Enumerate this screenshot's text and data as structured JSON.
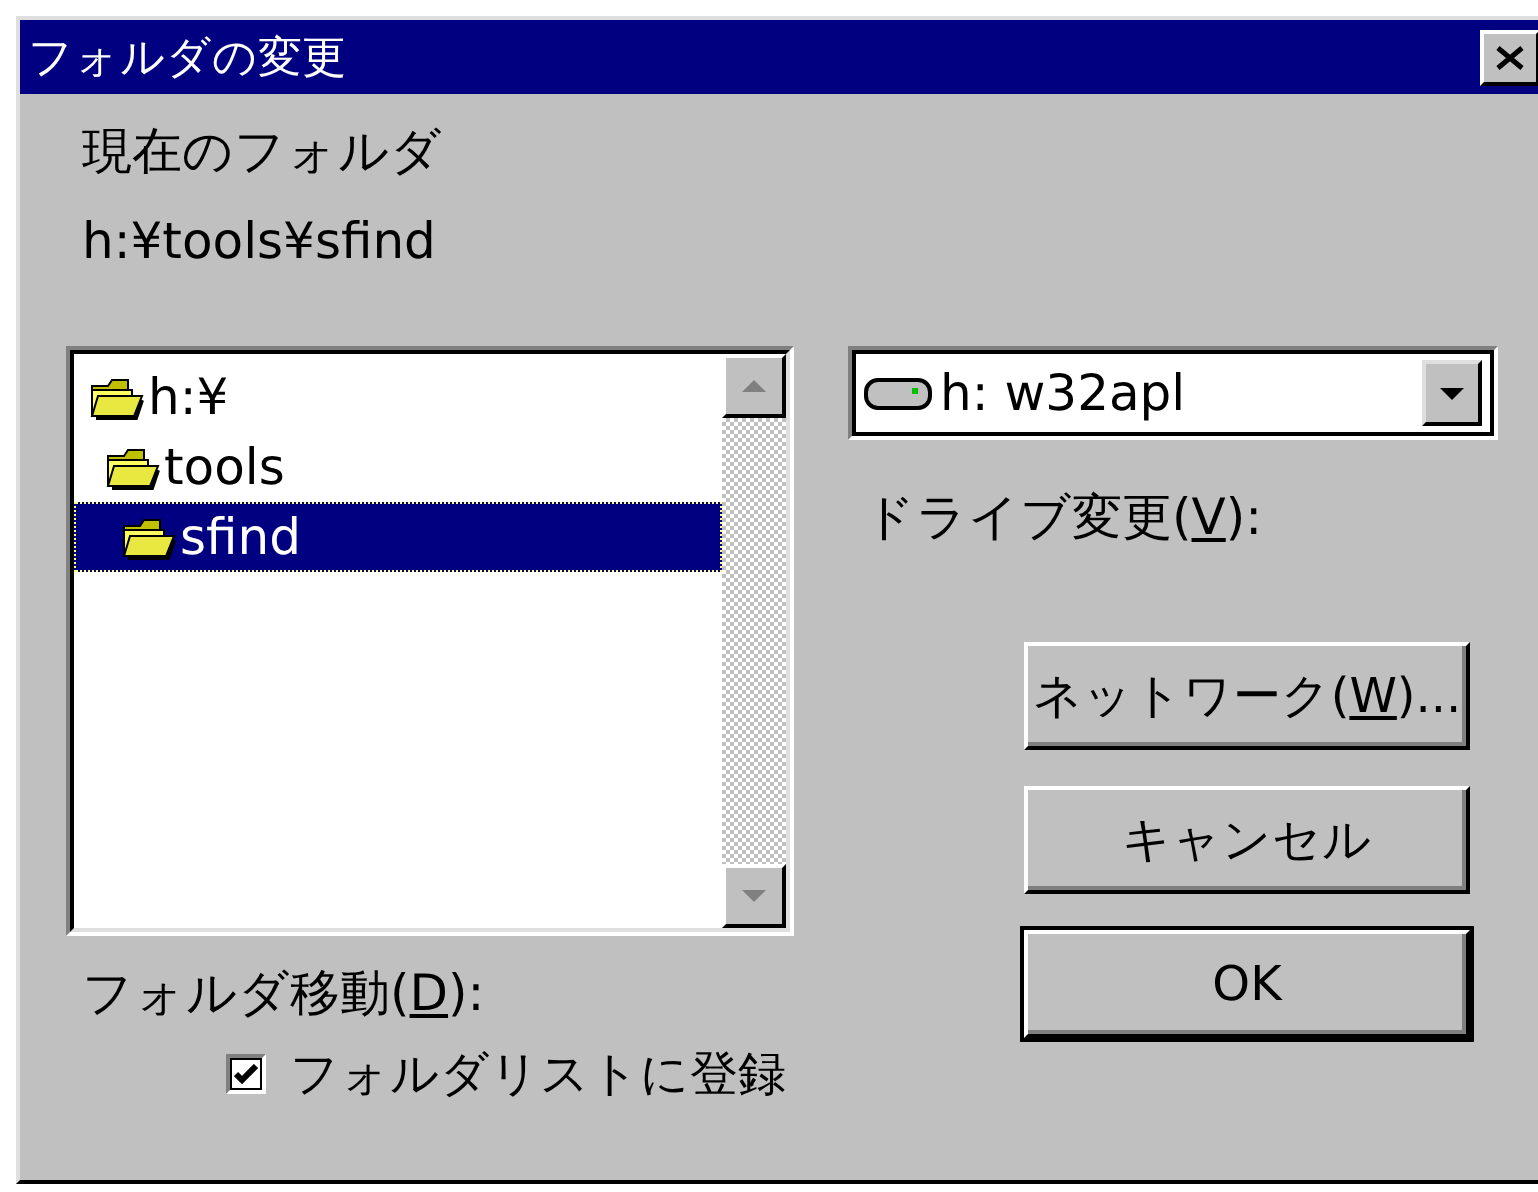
{
  "window": {
    "title": "フォルダの変更"
  },
  "current_folder": {
    "label": "現在のフォルダ",
    "path": "h:¥tools¥sfind"
  },
  "folder_tree": {
    "items": [
      {
        "label": "h:¥",
        "selected": false,
        "children": [
          {
            "label": "tools",
            "selected": false,
            "children": [
              {
                "label": "sfind",
                "selected": true
              }
            ]
          }
        ]
      }
    ]
  },
  "folder_move_label": {
    "parts": [
      "フォルダ移動(",
      "D",
      "):"
    ]
  },
  "register_checkbox": {
    "label": "フォルダリストに登録",
    "checked": true
  },
  "drive": {
    "value": "h: w32apl",
    "label_parts": [
      "ドライブ変更(",
      "V",
      "):"
    ]
  },
  "buttons": [
    {
      "parts": [
        "ネットワーク(",
        "W",
        ")..."
      ],
      "default": false
    },
    {
      "parts": [
        "キャンセル"
      ],
      "default": false
    },
    {
      "parts": [
        "OK"
      ],
      "default": true
    }
  ]
}
